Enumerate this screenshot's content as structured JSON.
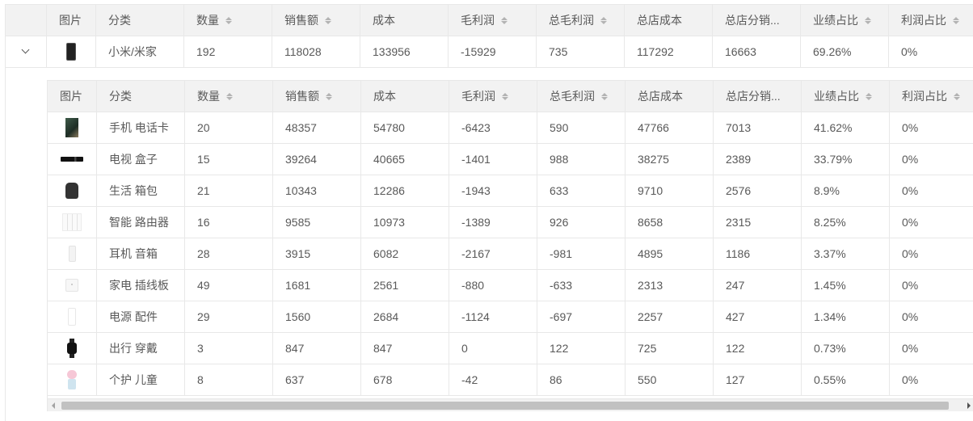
{
  "columns": [
    {
      "key": "image",
      "label": "图片",
      "sortable": false
    },
    {
      "key": "category",
      "label": "分类",
      "sortable": false
    },
    {
      "key": "quantity",
      "label": "数量",
      "sortable": true
    },
    {
      "key": "sales",
      "label": "销售额",
      "sortable": true
    },
    {
      "key": "cost",
      "label": "成本",
      "sortable": false
    },
    {
      "key": "gross_profit",
      "label": "毛利润",
      "sortable": true
    },
    {
      "key": "total_gross_profit",
      "label": "总毛利润",
      "sortable": true
    },
    {
      "key": "store_cost",
      "label": "总店成本",
      "sortable": false
    },
    {
      "key": "store_distribution",
      "label": "总店分销...",
      "sortable": false
    },
    {
      "key": "performance_share",
      "label": "业绩占比",
      "sortable": true
    },
    {
      "key": "profit_share",
      "label": "利润占比",
      "sortable": true
    }
  ],
  "parent_row": {
    "icon": "phone-dark",
    "category": "小米/米家",
    "quantity": "192",
    "sales": "118028",
    "cost": "133956",
    "gross_profit": "-15929",
    "total_gross_profit": "735",
    "store_cost": "117292",
    "store_distribution": "16663",
    "performance_share": "69.26%",
    "profit_share": "0%"
  },
  "child_rows": [
    {
      "icon": "phone-green",
      "category": "手机 电话卡",
      "quantity": "20",
      "sales": "48357",
      "cost": "54780",
      "gross_profit": "-6423",
      "total_gross_profit": "590",
      "store_cost": "47766",
      "store_distribution": "7013",
      "performance_share": "41.62%",
      "profit_share": "0%"
    },
    {
      "icon": "tvbox",
      "category": "电视 盒子",
      "quantity": "15",
      "sales": "39264",
      "cost": "40665",
      "gross_profit": "-1401",
      "total_gross_profit": "988",
      "store_cost": "38275",
      "store_distribution": "2389",
      "performance_share": "33.79%",
      "profit_share": "0%"
    },
    {
      "icon": "bag",
      "category": "生活 箱包",
      "quantity": "21",
      "sales": "10343",
      "cost": "12286",
      "gross_profit": "-1943",
      "total_gross_profit": "633",
      "store_cost": "9710",
      "store_distribution": "2576",
      "performance_share": "8.9%",
      "profit_share": "0%"
    },
    {
      "icon": "router",
      "category": "智能 路由器",
      "quantity": "16",
      "sales": "9585",
      "cost": "10973",
      "gross_profit": "-1389",
      "total_gross_profit": "926",
      "store_cost": "8658",
      "store_distribution": "2315",
      "performance_share": "8.25%",
      "profit_share": "0%"
    },
    {
      "icon": "speaker",
      "category": "耳机 音箱",
      "quantity": "28",
      "sales": "3915",
      "cost": "6082",
      "gross_profit": "-2167",
      "total_gross_profit": "-981",
      "store_cost": "4895",
      "store_distribution": "1186",
      "performance_share": "3.37%",
      "profit_share": "0%"
    },
    {
      "icon": "plug",
      "category": "家电 插线板",
      "quantity": "49",
      "sales": "1681",
      "cost": "2561",
      "gross_profit": "-880",
      "total_gross_profit": "-633",
      "store_cost": "2313",
      "store_distribution": "247",
      "performance_share": "1.45%",
      "profit_share": "0%"
    },
    {
      "icon": "powerbank",
      "category": "电源 配件",
      "quantity": "29",
      "sales": "1560",
      "cost": "2684",
      "gross_profit": "-1124",
      "total_gross_profit": "-697",
      "store_cost": "2257",
      "store_distribution": "427",
      "performance_share": "1.34%",
      "profit_share": "0%"
    },
    {
      "icon": "watch",
      "category": "出行 穿戴",
      "quantity": "3",
      "sales": "847",
      "cost": "847",
      "gross_profit": "0",
      "total_gross_profit": "122",
      "store_cost": "725",
      "store_distribution": "122",
      "performance_share": "0.73%",
      "profit_share": "0%"
    },
    {
      "icon": "doll",
      "category": "个护 儿童",
      "quantity": "8",
      "sales": "637",
      "cost": "678",
      "gross_profit": "-42",
      "total_gross_profit": "86",
      "store_cost": "550",
      "store_distribution": "127",
      "performance_share": "0.55%",
      "profit_share": "0%"
    }
  ],
  "colors": {
    "header_bg": "#f2f2f2",
    "border": "#e8e8e8",
    "text": "#595959"
  }
}
